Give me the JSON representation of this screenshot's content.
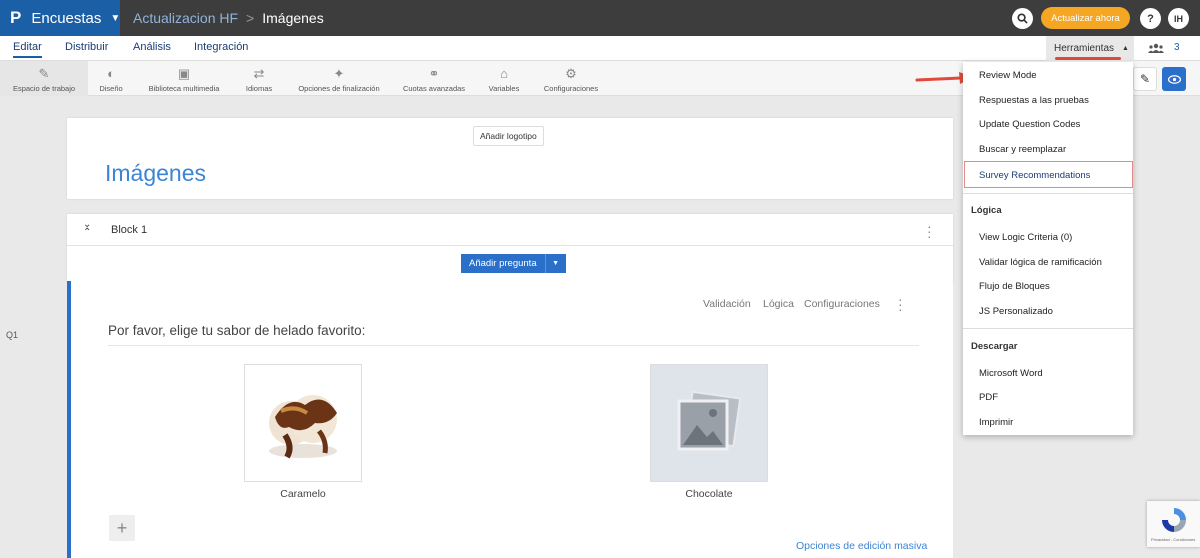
{
  "app": {
    "name": "Encuestas",
    "logo_letter": "P"
  },
  "breadcrumb": {
    "survey": "Actualizacion HF",
    "page": "Imágenes"
  },
  "topbar": {
    "search_icon": "search-icon",
    "update_label": "Actualizar ahora",
    "help": "?",
    "avatar": "IH"
  },
  "nav": {
    "edit": "Editar",
    "distribute": "Distribuir",
    "analysis": "Análisis",
    "integration": "Integración",
    "tools": "Herramientas",
    "collab_count": "3"
  },
  "toolbar": {
    "items": [
      {
        "label": "Espacio de trabajo",
        "icon": "workspace-icon"
      },
      {
        "label": "Diseño",
        "icon": "palette-icon"
      },
      {
        "label": "Biblioteca multimedia",
        "icon": "image-icon"
      },
      {
        "label": "Idiomas",
        "icon": "translate-icon"
      },
      {
        "label": "Opciones de finalización",
        "icon": "wand-icon"
      },
      {
        "label": "Cuotas avanzadas",
        "icon": "link-icon"
      },
      {
        "label": "Variables",
        "icon": "tag-icon"
      },
      {
        "label": "Configuraciones",
        "icon": "gear-icon"
      }
    ]
  },
  "header_card": {
    "add_logo": "Añadir logotipo",
    "title": "Imágenes"
  },
  "block": {
    "name": "Block 1",
    "add_question": "Añadir pregunta"
  },
  "question": {
    "id": "Q1",
    "links": {
      "validation": "Validación",
      "logic": "Lógica",
      "settings": "Configuraciones"
    },
    "text": "Por favor, elige tu sabor de helado favorito:",
    "options": [
      {
        "label": "Caramelo"
      },
      {
        "label": "Chocolate"
      }
    ],
    "bulk_edit": "Opciones de edición masiva"
  },
  "tools_menu": {
    "items1": [
      "Review Mode",
      "Respuestas a las pruebas",
      "Update Question Codes",
      "Buscar y reemplazar",
      "Survey Recommendations"
    ],
    "logic_header": "Lógica",
    "logic_items": [
      "View Logic Criteria (0)",
      "Validar lógica de ramificación",
      "Flujo de Bloques",
      "JS Personalizado"
    ],
    "download_header": "Descargar",
    "download_items": [
      "Microsoft Word",
      "PDF",
      "Imprimir"
    ]
  },
  "recaptcha": {
    "privacy": "Privacidad - Condiciones"
  },
  "colors": {
    "brand": "#1b5fa6",
    "accent": "#f5a623",
    "topbar": "#3d3d3d",
    "highlight": "#e14a3a"
  }
}
